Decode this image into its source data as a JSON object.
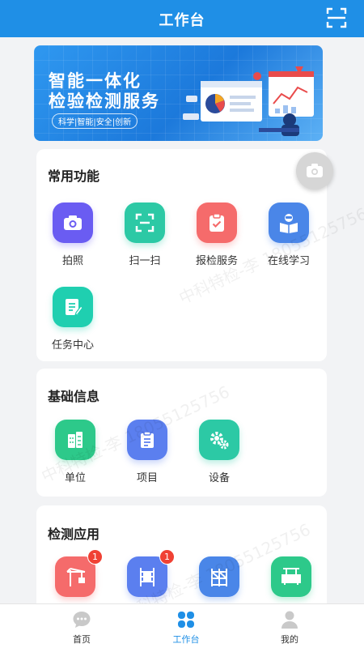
{
  "header": {
    "title": "工作台",
    "scan_icon": "scan-icon"
  },
  "banner": {
    "title_line1": "智能一体化",
    "title_line2": "检验检测服务",
    "tags": "科学|智能|安全|创新"
  },
  "common": {
    "title": "常用功能",
    "items": [
      {
        "label": "拍照",
        "icon": "camera-icon"
      },
      {
        "label": "扫一扫",
        "icon": "scan-icon"
      },
      {
        "label": "报检服务",
        "icon": "clipboard-check-icon"
      },
      {
        "label": "在线学习",
        "icon": "reading-icon"
      },
      {
        "label": "任务中心",
        "icon": "note-pen-icon"
      }
    ]
  },
  "basic": {
    "title": "基础信息",
    "items": [
      {
        "label": "单位",
        "icon": "building-icon"
      },
      {
        "label": "项目",
        "icon": "clipboard-icon"
      },
      {
        "label": "设备",
        "icon": "gears-icon"
      }
    ]
  },
  "apps": {
    "title": "检测应用",
    "items": [
      {
        "icon": "tower-crane-icon",
        "badge": "1"
      },
      {
        "icon": "construction-hoist-icon",
        "badge": "1"
      },
      {
        "icon": "scaffold-icon"
      },
      {
        "icon": "gondola-icon"
      }
    ]
  },
  "watermark": "中科特检-李 18055125756",
  "tabbar": [
    {
      "label": "首页",
      "icon": "chat-bubble-icon"
    },
    {
      "label": "工作台",
      "icon": "workbench-grid-icon"
    },
    {
      "label": "我的",
      "icon": "user-icon"
    }
  ],
  "colors": {
    "primary": "#1f8fe6",
    "badge": "#f04134"
  }
}
